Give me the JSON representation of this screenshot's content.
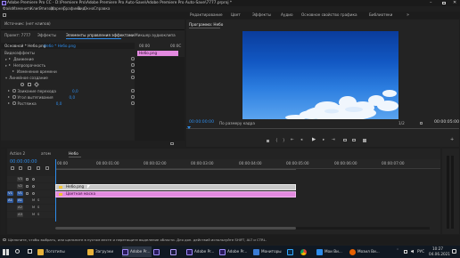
{
  "window": {
    "title": "Adobe Premiere Pro CC - D:\\Premiere Pro\\Adobe Premiere Pro Auto-Save\\Adobe Premiere Pro Auto-Save\\7777.prproj *"
  },
  "menu": [
    "Файл",
    "Изменить",
    "Клип",
    "Эпизод",
    "Маркер",
    "Графика",
    "Вид",
    "Окно",
    "Справка"
  ],
  "workspaces": [
    "Редактирование",
    "Цвет",
    "Эффекты",
    "Аудио",
    "Основное свойство графика",
    "Библиотеки"
  ],
  "source_panel": {
    "tab_source": "Источник: (нет клипов)",
    "tab_project": "Проект: 7777",
    "tab_effects": "Эффекты",
    "tab_effect_controls": "Элементы управления эффектами",
    "tab_lumetri": "Микшер аудиоклипа",
    "clip_path": "Основной * Небо.png",
    "clip_link": "Небо * Небо.png",
    "timecode_header": "00:00",
    "timecode_right": "00:0C",
    "clip_label": "Небо.png",
    "section_video": "Видеоэффекты",
    "rows": [
      "Движение",
      "Непрозрачность",
      "Изменение времени",
      "Линейное создание",
      "Заикание перехода",
      "Угол вытягивания",
      "Растяжка"
    ],
    "values": [
      "0,0",
      "0,0",
      "0,0"
    ]
  },
  "program_panel": {
    "title": "Программа: Небо",
    "timecode_left": "00:00:00:00",
    "fit_label": "По размеру кадра",
    "quality": "1/2",
    "timecode_right": "00:00:05:00"
  },
  "timeline": {
    "tabs": [
      "Action 2",
      "атом",
      "Небо"
    ],
    "timecode": "00:00:00:00",
    "ruler": [
      "00:00",
      "00:00:01:00",
      "00:00:02:00",
      "00:00:03:00",
      "00:00:04:00",
      "00:00:05:00",
      "00:00:06:00",
      "00:00:07:00"
    ],
    "tracks_video": [
      "V3",
      "V2",
      "V1"
    ],
    "tracks_audio": [
      "A1",
      "A2",
      "A3"
    ],
    "clip_top": "Небо.png",
    "clip_bottom": "Цветная маска"
  },
  "status_bar": {
    "text": "Щелкните, чтобы выбрать, или щелкните в пустом месте и перетащите выделение области. Для доп. действий используйте SHIFT, ALT и CTRL."
  },
  "taskbar": {
    "items": [
      "Логотипы",
      "Загрузки",
      "Adobe Pr...",
      "Adobe Pr...",
      "Adobe Pr...",
      "Мониторы",
      "Мои Ви...",
      "Мозил Ви..."
    ],
    "lang": "РУС",
    "time": "10:27",
    "date": "04.06.2021"
  },
  "colors": {
    "accent_blue": "#2d8ceb",
    "clip_pink": "#e38ae0",
    "clip_gray": "#c7c7c7",
    "track_blue": "#2f5a9e"
  }
}
